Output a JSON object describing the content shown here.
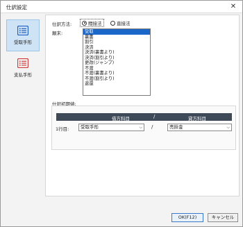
{
  "window": {
    "title": "仕訳設定",
    "close_glyph": "✕"
  },
  "sidebar": {
    "items": [
      {
        "label": "受取手形",
        "active": true,
        "color": "#1f5fbf"
      },
      {
        "label": "支払手形",
        "active": false,
        "color": "#d23b3b"
      }
    ]
  },
  "form": {
    "method_label": "仕訳方法:",
    "method_options": [
      {
        "label": "間接法",
        "checked": true
      },
      {
        "label": "直接法",
        "checked": false
      }
    ],
    "status_label": "顛末:",
    "status_options": [
      "受取",
      "裏書",
      "割引",
      "決済",
      "決済(裏書より)",
      "決済(割引より)",
      "更改(ジャンプ)",
      "不渡",
      "不渡(裏書より)",
      "不渡(割引より)",
      "返還"
    ],
    "status_selected": "受取",
    "journal_group_label": "仕訳初期値:",
    "table": {
      "debit_header": "借方科目",
      "separator": "/",
      "credit_header": "貸方科目",
      "row_label": "1行目:",
      "debit_value": "受取手形",
      "credit_value": "売掛金"
    }
  },
  "footer": {
    "ok_label": "OK(F12)",
    "cancel_label": "キャンセル"
  }
}
